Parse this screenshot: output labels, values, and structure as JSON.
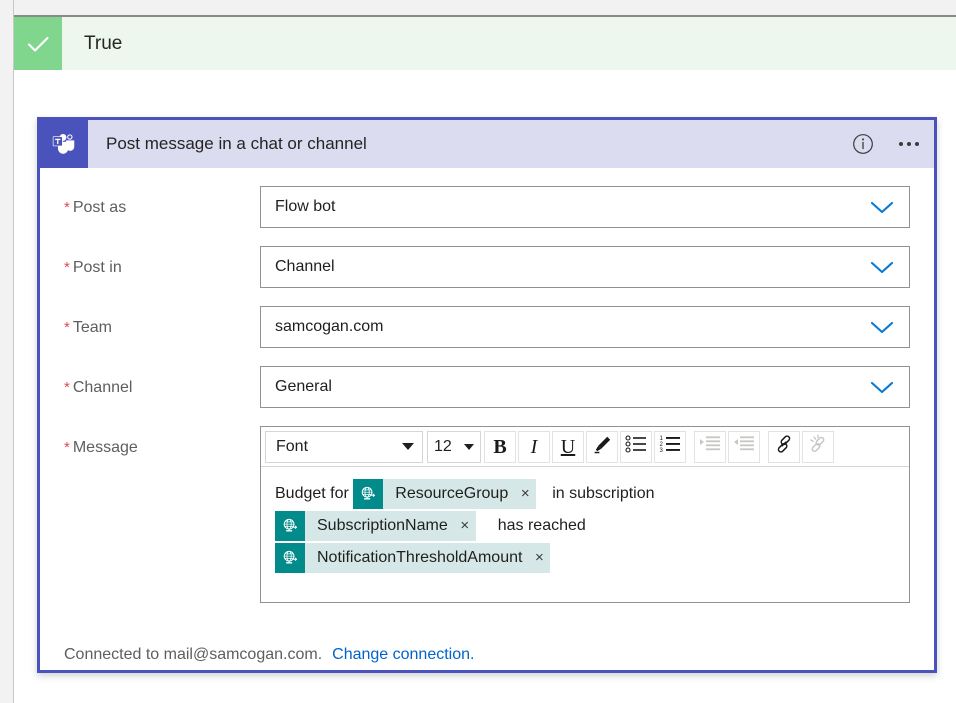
{
  "status_banner": {
    "label": "True",
    "icon": "check-icon",
    "check_color": "#81d68d",
    "background": "#edf7ed"
  },
  "card": {
    "title": "Post message in a chat or channel",
    "connector_icon": "microsoft-teams-icon",
    "accent_color": "#4a53bc",
    "header_background": "#dcdcf0",
    "info_icon": "info-icon",
    "more_icon": "ellipsis-icon",
    "fields": [
      {
        "label": "Post as",
        "required": "*",
        "value": "Flow bot",
        "chevron": "chevron-down-icon"
      },
      {
        "label": "Post in",
        "required": "*",
        "value": "Channel",
        "chevron": "chevron-down-icon"
      },
      {
        "label": "Team",
        "required": "*",
        "value": "samcogan.com",
        "chevron": "chevron-down-icon"
      },
      {
        "label": "Channel",
        "required": "*",
        "value": "General",
        "chevron": "chevron-down-icon"
      }
    ],
    "message": {
      "label": "Message",
      "required": "*",
      "toolbar": {
        "font_name": "Font",
        "font_size": "12",
        "bold": "B",
        "italic": "I",
        "underline": "U",
        "buttons": [
          {
            "name": "highlighter-icon",
            "enabled": true
          },
          {
            "name": "bulleted-list-icon",
            "enabled": true
          },
          {
            "name": "numbered-list-icon",
            "enabled": true
          },
          {
            "name": "increase-indent-icon",
            "enabled": false
          },
          {
            "name": "decrease-indent-icon",
            "enabled": false
          },
          {
            "name": "insert-link-icon",
            "enabled": true
          },
          {
            "name": "remove-link-icon",
            "enabled": false
          }
        ]
      },
      "content": {
        "line1_prefix": "Budget for ",
        "token1": {
          "text": "ResourceGroup",
          "icon": "http-globe-icon",
          "remove": "×"
        },
        "line1_suffix": "in subscription",
        "token2": {
          "text": "SubscriptionName",
          "icon": "http-globe-icon",
          "remove": "×"
        },
        "line2_suffix": "has reached",
        "token3": {
          "text": "NotificationThresholdAmount",
          "icon": "http-globe-icon",
          "remove": "×"
        }
      },
      "token_icon_color": "#018b8b",
      "token_background": "#d5e8e7"
    },
    "footer": {
      "connected_text": "Connected to mail@samcogan.com.",
      "change_link": "Change connection.",
      "link_color": "#0264c8"
    }
  }
}
